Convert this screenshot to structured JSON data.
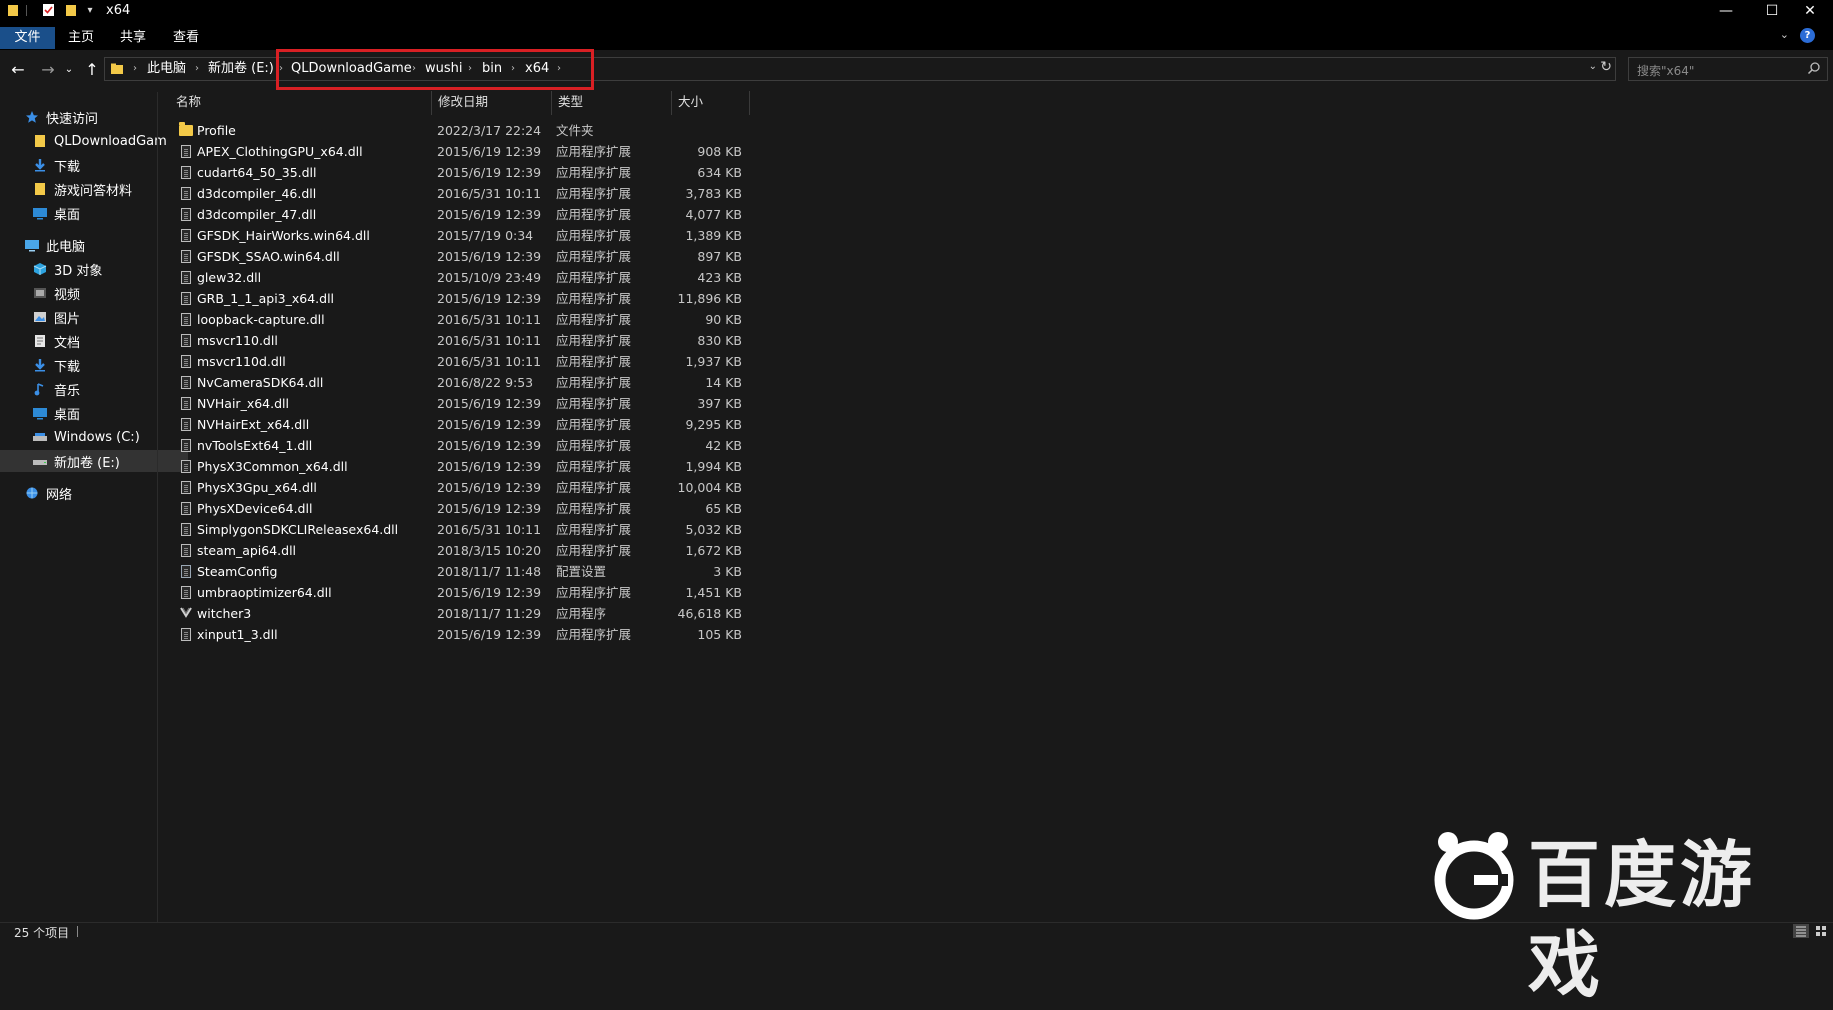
{
  "window": {
    "title": "x64",
    "controls": {
      "minimize": "—",
      "maximize": "☐",
      "close": "✕"
    }
  },
  "ribbon": {
    "tabs": [
      {
        "label": "文件"
      },
      {
        "label": "主页"
      },
      {
        "label": "共享"
      },
      {
        "label": "查看"
      }
    ]
  },
  "address_bar": {
    "crumbs": [
      "此电脑",
      "新加卷 (E:)",
      "QLDownloadGame",
      "wushi",
      "bin",
      "x64"
    ]
  },
  "search": {
    "placeholder": "搜索\"x64\""
  },
  "sidebar": {
    "items": [
      {
        "label": "快速访问",
        "icon": "star-icon",
        "level": 0
      },
      {
        "label": "QLDownloadGam",
        "icon": "folder-icon",
        "level": 1
      },
      {
        "label": "下载",
        "icon": "download-icon",
        "level": 1
      },
      {
        "label": "游戏问答材料",
        "icon": "folder-icon",
        "level": 1
      },
      {
        "label": "桌面",
        "icon": "desktop-icon",
        "level": 1
      },
      {
        "label": "此电脑",
        "icon": "computer-icon",
        "level": 0
      },
      {
        "label": "3D 对象",
        "icon": "cube-icon",
        "level": 1
      },
      {
        "label": "视频",
        "icon": "video-icon",
        "level": 1
      },
      {
        "label": "图片",
        "icon": "picture-icon",
        "level": 1
      },
      {
        "label": "文档",
        "icon": "document-icon",
        "level": 1
      },
      {
        "label": "下载",
        "icon": "download-icon",
        "level": 1
      },
      {
        "label": "音乐",
        "icon": "music-icon",
        "level": 1
      },
      {
        "label": "桌面",
        "icon": "desktop-icon",
        "level": 1
      },
      {
        "label": "Windows (C:)",
        "icon": "drive-icon",
        "level": 1
      },
      {
        "label": "新加卷 (E:)",
        "icon": "drive-icon",
        "level": 1,
        "selected": true
      },
      {
        "label": "网络",
        "icon": "network-icon",
        "level": 0
      }
    ]
  },
  "columns": [
    "名称",
    "修改日期",
    "类型",
    "大小"
  ],
  "files": [
    {
      "name": "Profile",
      "date": "2022/3/17 22:24",
      "type": "文件夹",
      "size": "",
      "icon": "folder-icon"
    },
    {
      "name": "APEX_ClothingGPU_x64.dll",
      "date": "2015/6/19 12:39",
      "type": "应用程序扩展",
      "size": "908 KB",
      "icon": "dll-file-icon"
    },
    {
      "name": "cudart64_50_35.dll",
      "date": "2015/6/19 12:39",
      "type": "应用程序扩展",
      "size": "634 KB",
      "icon": "dll-file-icon"
    },
    {
      "name": "d3dcompiler_46.dll",
      "date": "2016/5/31 10:11",
      "type": "应用程序扩展",
      "size": "3,783 KB",
      "icon": "dll-file-icon"
    },
    {
      "name": "d3dcompiler_47.dll",
      "date": "2015/6/19 12:39",
      "type": "应用程序扩展",
      "size": "4,077 KB",
      "icon": "dll-file-icon"
    },
    {
      "name": "GFSDK_HairWorks.win64.dll",
      "date": "2015/7/19 0:34",
      "type": "应用程序扩展",
      "size": "1,389 KB",
      "icon": "dll-file-icon"
    },
    {
      "name": "GFSDK_SSAO.win64.dll",
      "date": "2015/6/19 12:39",
      "type": "应用程序扩展",
      "size": "897 KB",
      "icon": "dll-file-icon"
    },
    {
      "name": "glew32.dll",
      "date": "2015/10/9 23:49",
      "type": "应用程序扩展",
      "size": "423 KB",
      "icon": "dll-file-icon"
    },
    {
      "name": "GRB_1_1_api3_x64.dll",
      "date": "2015/6/19 12:39",
      "type": "应用程序扩展",
      "size": "11,896 KB",
      "icon": "dll-file-icon"
    },
    {
      "name": "loopback-capture.dll",
      "date": "2016/5/31 10:11",
      "type": "应用程序扩展",
      "size": "90 KB",
      "icon": "dll-file-icon"
    },
    {
      "name": "msvcr110.dll",
      "date": "2016/5/31 10:11",
      "type": "应用程序扩展",
      "size": "830 KB",
      "icon": "dll-file-icon"
    },
    {
      "name": "msvcr110d.dll",
      "date": "2016/5/31 10:11",
      "type": "应用程序扩展",
      "size": "1,937 KB",
      "icon": "dll-file-icon"
    },
    {
      "name": "NvCameraSDK64.dll",
      "date": "2016/8/22 9:53",
      "type": "应用程序扩展",
      "size": "14 KB",
      "icon": "dll-file-icon"
    },
    {
      "name": "NVHair_x64.dll",
      "date": "2015/6/19 12:39",
      "type": "应用程序扩展",
      "size": "397 KB",
      "icon": "dll-file-icon"
    },
    {
      "name": "NVHairExt_x64.dll",
      "date": "2015/6/19 12:39",
      "type": "应用程序扩展",
      "size": "9,295 KB",
      "icon": "dll-file-icon"
    },
    {
      "name": "nvToolsExt64_1.dll",
      "date": "2015/6/19 12:39",
      "type": "应用程序扩展",
      "size": "42 KB",
      "icon": "dll-file-icon"
    },
    {
      "name": "PhysX3Common_x64.dll",
      "date": "2015/6/19 12:39",
      "type": "应用程序扩展",
      "size": "1,994 KB",
      "icon": "dll-file-icon"
    },
    {
      "name": "PhysX3Gpu_x64.dll",
      "date": "2015/6/19 12:39",
      "type": "应用程序扩展",
      "size": "10,004 KB",
      "icon": "dll-file-icon"
    },
    {
      "name": "PhysXDevice64.dll",
      "date": "2015/6/19 12:39",
      "type": "应用程序扩展",
      "size": "65 KB",
      "icon": "dll-file-icon"
    },
    {
      "name": "SimplygonSDKCLIReleasex64.dll",
      "date": "2016/5/31 10:11",
      "type": "应用程序扩展",
      "size": "5,032 KB",
      "icon": "dll-file-icon"
    },
    {
      "name": "steam_api64.dll",
      "date": "2018/3/15 10:20",
      "type": "应用程序扩展",
      "size": "1,672 KB",
      "icon": "dll-file-icon"
    },
    {
      "name": "SteamConfig",
      "date": "2018/11/7 11:48",
      "type": "配置设置",
      "size": "3 KB",
      "icon": "config-file-icon"
    },
    {
      "name": "umbraoptimizer64.dll",
      "date": "2015/6/19 12:39",
      "type": "应用程序扩展",
      "size": "1,451 KB",
      "icon": "dll-file-icon"
    },
    {
      "name": "witcher3",
      "date": "2018/11/7 11:29",
      "type": "应用程序",
      "size": "46,618 KB",
      "icon": "app-icon"
    },
    {
      "name": "xinput1_3.dll",
      "date": "2015/6/19 12:39",
      "type": "应用程序扩展",
      "size": "105 KB",
      "icon": "dll-file-icon"
    }
  ],
  "status": {
    "item_count": "25 个项目"
  },
  "watermark": {
    "text": "百度游戏"
  },
  "colors": {
    "background": "#191919",
    "chrome": "#000000",
    "file_tab": "#1a4f8a",
    "highlight_box": "#d92024",
    "folder": "#f3c948"
  }
}
